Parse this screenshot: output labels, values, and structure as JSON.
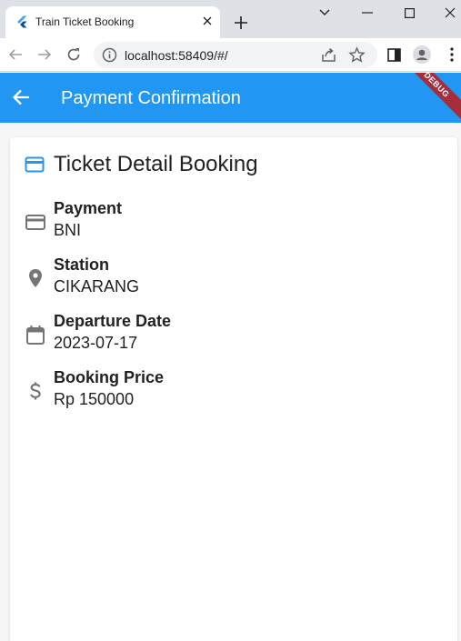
{
  "browser": {
    "tab_title": "Train Ticket Booking",
    "url": "localhost:58409/#/"
  },
  "appbar": {
    "title": "Payment Confirmation",
    "debug_label": "DEBUG",
    "color": "#2196f3"
  },
  "card": {
    "title": "Ticket Detail Booking",
    "header_icon": "credit-card-icon",
    "details": [
      {
        "icon": "credit-card-icon",
        "label": "Payment",
        "value": "BNI"
      },
      {
        "icon": "location-pin-icon",
        "label": "Station",
        "value": "CIKARANG"
      },
      {
        "icon": "calendar-icon",
        "label": "Departure Date",
        "value": "2023-07-17"
      },
      {
        "icon": "dollar-icon",
        "label": "Booking Price",
        "value": "Rp 150000"
      }
    ]
  }
}
